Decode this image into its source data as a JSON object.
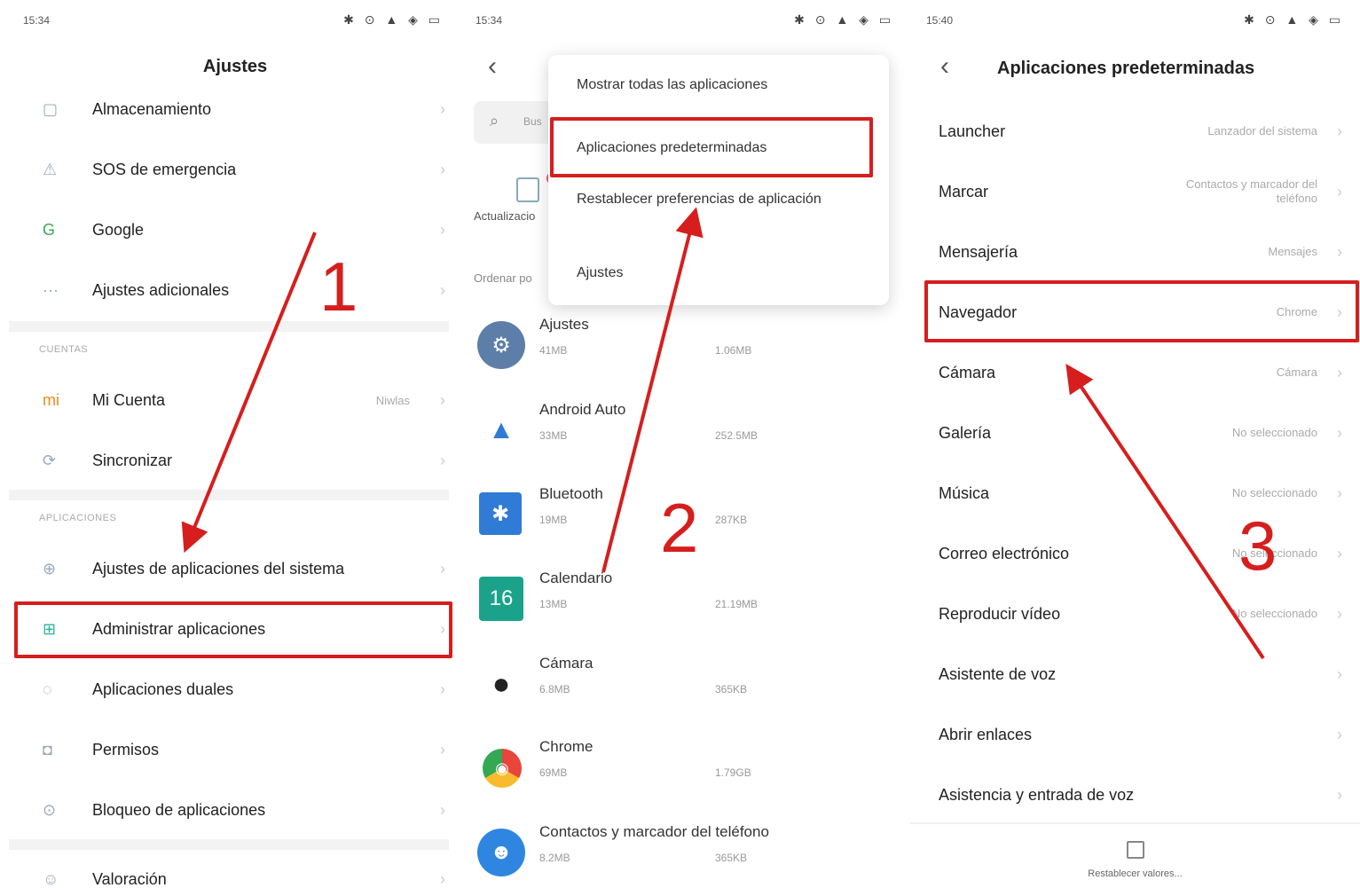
{
  "panel1": {
    "time": "15:34",
    "status_icons": "✱ ⊙ ▲ ◈ ▭",
    "title": "Ajustes",
    "rows_top": [
      {
        "icon": "▢",
        "label": "Almacenamiento"
      },
      {
        "icon": "⚠",
        "label": "SOS de emergencia"
      },
      {
        "icon": "G",
        "label": "Google"
      },
      {
        "icon": "···",
        "label": "Ajustes adicionales"
      }
    ],
    "section_cuentas": "CUENTAS",
    "rows_cuentas": [
      {
        "icon": "mi",
        "label": "Mi Cuenta",
        "value": "Niwlas"
      },
      {
        "icon": "⟳",
        "label": "Sincronizar"
      }
    ],
    "section_apps": "APLICACIONES",
    "rows_apps": [
      {
        "icon": "⊕",
        "label": "Ajustes de aplicaciones del sistema"
      },
      {
        "icon": "⊞",
        "label": "Administrar aplicaciones"
      },
      {
        "icon": "◌",
        "label": "Aplicaciones duales"
      },
      {
        "icon": "◘",
        "label": "Permisos"
      },
      {
        "icon": "⊙",
        "label": "Bloqueo de aplicaciones"
      }
    ],
    "row_last": {
      "icon": "☺",
      "label": "Valoración"
    },
    "chevron": "›",
    "step": "1"
  },
  "panel2": {
    "time": "15:34",
    "status_icons": "✱ ⊙ ▲ ◈ ▭",
    "back": "‹",
    "search_placeholder": "Bus",
    "update_label": "Actualizacio",
    "sort_label": "Ordenar po",
    "menu": [
      "Mostrar todas las aplicaciones",
      "Aplicaciones predeterminadas",
      "Restablecer preferencias de aplicación",
      "Ajustes"
    ],
    "apps": [
      {
        "name": "Ajustes",
        "size": "41MB",
        "cache": "1.06MB",
        "icon": "⚙",
        "color": "#5d7ea8"
      },
      {
        "name": "Android Auto",
        "size": "33MB",
        "cache": "252.5MB",
        "icon": "▲",
        "color": "#ffffff"
      },
      {
        "name": "Bluetooth",
        "size": "19MB",
        "cache": "287KB",
        "icon": "✱",
        "color": "#2f7bd6"
      },
      {
        "name": "Calendario",
        "size": "13MB",
        "cache": "21.19MB",
        "icon": "16",
        "color": "#1aa38a"
      },
      {
        "name": "Cámara",
        "size": "6.8MB",
        "cache": "365KB",
        "icon": "●",
        "color": "#222222"
      },
      {
        "name": "Chrome",
        "size": "69MB",
        "cache": "1.79GB",
        "icon": "◉",
        "color": "#e8453c"
      },
      {
        "name": "Contactos y marcador del teléfono",
        "size": "8.2MB",
        "cache": "365KB",
        "icon": "☻",
        "color": "#2f86e0"
      }
    ],
    "step": "2"
  },
  "panel3": {
    "time": "15:40",
    "status_icons": "✱ ⊙ ▲ ◈ ▭",
    "back": "‹",
    "title": "Aplicaciones predeterminadas",
    "rows": [
      {
        "label": "Launcher",
        "value": "Lanzador del sistema"
      },
      {
        "label": "Marcar",
        "value": "Contactos y marcador del teléfono"
      },
      {
        "label": "Mensajería",
        "value": "Mensajes"
      },
      {
        "label": "Navegador",
        "value": "Chrome"
      },
      {
        "label": "Cámara",
        "value": "Cámara"
      },
      {
        "label": "Galería",
        "value": "No seleccionado"
      },
      {
        "label": "Música",
        "value": "No seleccionado"
      },
      {
        "label": "Correo electrónico",
        "value": "No seleccionado"
      },
      {
        "label": "Reproducir vídeo",
        "value": "No seleccionado"
      },
      {
        "label": "Asistente de voz",
        "value": ""
      },
      {
        "label": "Abrir enlaces",
        "value": ""
      },
      {
        "label": "Asistencia y entrada de voz",
        "value": ""
      }
    ],
    "reset_label": "Restablecer valores...",
    "step": "3"
  },
  "colors": {
    "highlight": "#d61e1e"
  }
}
